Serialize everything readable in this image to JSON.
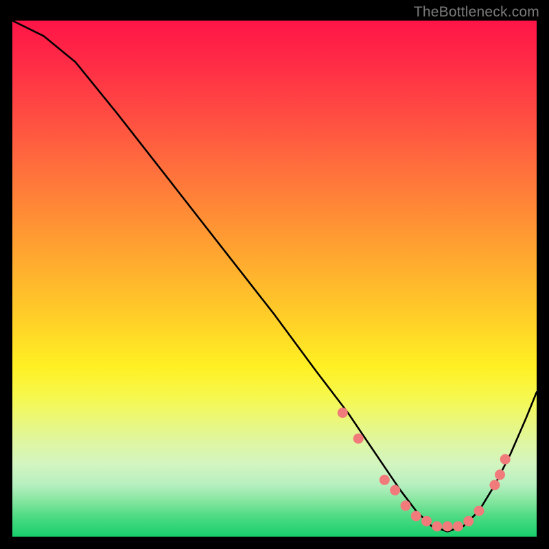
{
  "watermark": "TheBottleneck.com",
  "chart_data": {
    "type": "line",
    "title": "",
    "xlabel": "",
    "ylabel": "",
    "xlim": [
      0,
      100
    ],
    "ylim": [
      0,
      100
    ],
    "grid": false,
    "legend": false,
    "series": [
      {
        "name": "bottleneck-curve",
        "x": [
          0,
          6,
          12,
          20,
          30,
          40,
          50,
          58,
          64,
          68,
          72,
          74,
          77,
          80,
          83,
          86,
          89,
          92,
          95,
          98,
          100
        ],
        "values": [
          100,
          97,
          92,
          82,
          69,
          56,
          43,
          32,
          24,
          18,
          12,
          9,
          5,
          2,
          1,
          2,
          5,
          10,
          16,
          23,
          28
        ]
      }
    ],
    "markers": {
      "name": "highlighted-points",
      "color": "#f17a7a",
      "points": [
        {
          "x": 63,
          "y": 24
        },
        {
          "x": 66,
          "y": 19
        },
        {
          "x": 71,
          "y": 11
        },
        {
          "x": 73,
          "y": 9
        },
        {
          "x": 75,
          "y": 6
        },
        {
          "x": 77,
          "y": 4
        },
        {
          "x": 79,
          "y": 3
        },
        {
          "x": 81,
          "y": 2
        },
        {
          "x": 83,
          "y": 2
        },
        {
          "x": 85,
          "y": 2
        },
        {
          "x": 87,
          "y": 3
        },
        {
          "x": 89,
          "y": 5
        },
        {
          "x": 92,
          "y": 10
        },
        {
          "x": 93,
          "y": 12
        },
        {
          "x": 94,
          "y": 15
        }
      ]
    }
  }
}
